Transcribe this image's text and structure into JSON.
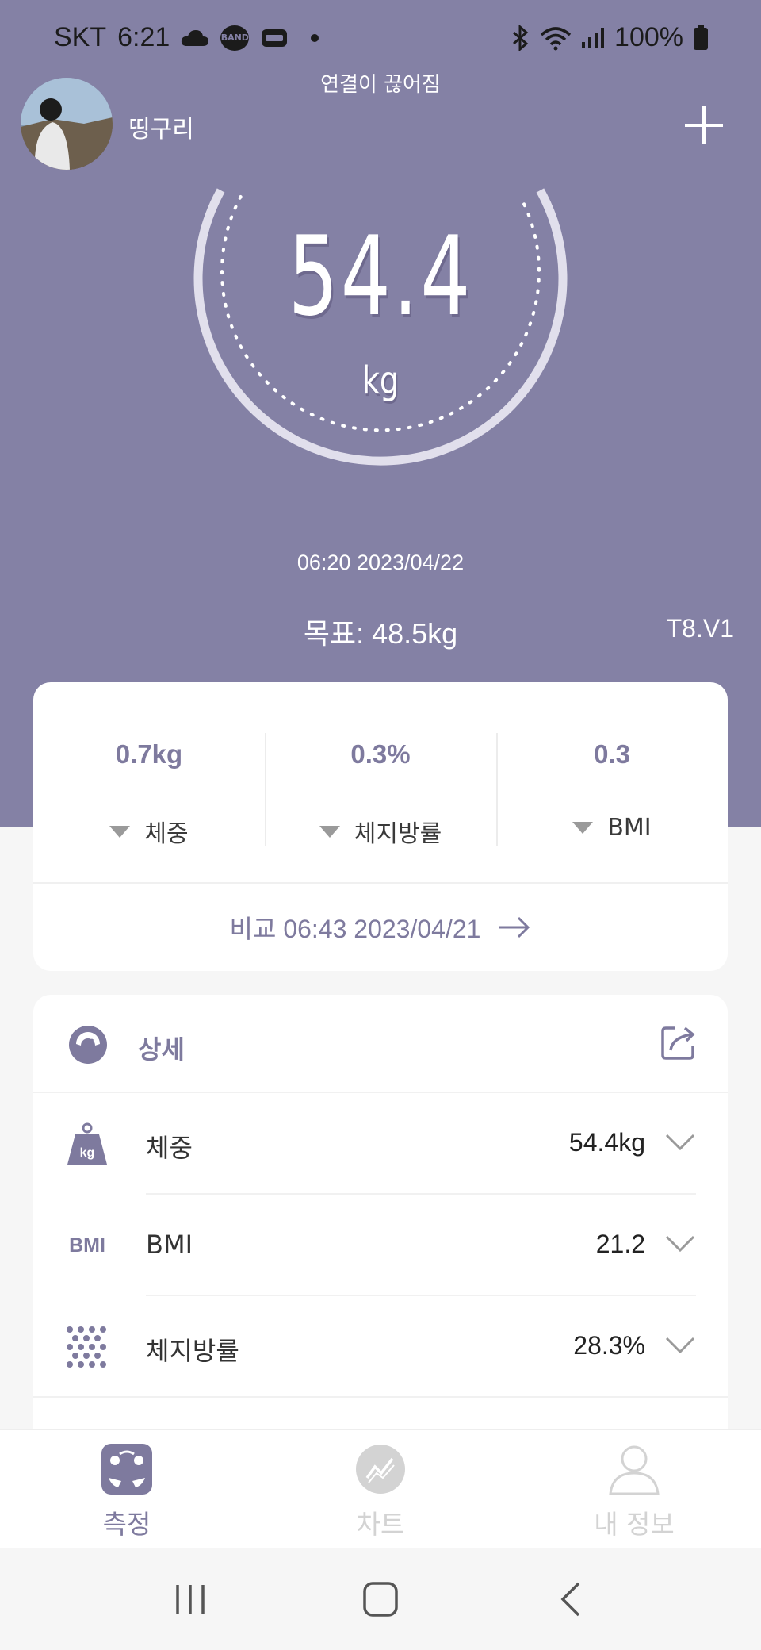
{
  "status_bar": {
    "carrier": "SKT",
    "time": "6:21",
    "battery": "100%",
    "icons": [
      "cloud-icon",
      "band-app-icon",
      "dashboard-app-icon",
      "notification-dot-icon",
      "bluetooth-icon",
      "wifi-icon",
      "signal-icon",
      "battery-icon"
    ]
  },
  "header": {
    "connection_status": "연결이 끊어짐",
    "username": "띵구리",
    "add_icon": "plus-icon"
  },
  "measurement": {
    "weight": "54.4",
    "unit": "kg",
    "time": "06:20 2023/04/22",
    "goal": "목표: 48.5kg",
    "device": "T8.V1"
  },
  "comparison": {
    "items": [
      {
        "value": "0.7kg",
        "label": "체중",
        "direction": "down"
      },
      {
        "value": "0.3%",
        "label": "체지방률",
        "direction": "down"
      },
      {
        "value": "0.3",
        "label": "BMI",
        "direction": "down"
      }
    ],
    "link_text": "비교 06:43 2023/04/21"
  },
  "details": {
    "title": "상세",
    "rows": [
      {
        "icon": "weight-kg-icon",
        "label": "체중",
        "value": "54.4kg"
      },
      {
        "icon": "bmi-icon",
        "icon_text": "BMI",
        "label": "BMI",
        "value": "21.2"
      },
      {
        "icon": "body-fat-dots-icon",
        "label": "체지방률",
        "value": "28.3%"
      }
    ]
  },
  "bottom_nav": {
    "items": [
      {
        "label": "측정",
        "icon": "scale-icon",
        "active": true
      },
      {
        "label": "차트",
        "icon": "chart-icon",
        "active": false
      },
      {
        "label": "내 정보",
        "icon": "profile-icon",
        "active": false
      }
    ]
  },
  "colors": {
    "accent": "#8481a5",
    "accent_text": "#7e7a9e",
    "background": "#f6f6f6"
  }
}
